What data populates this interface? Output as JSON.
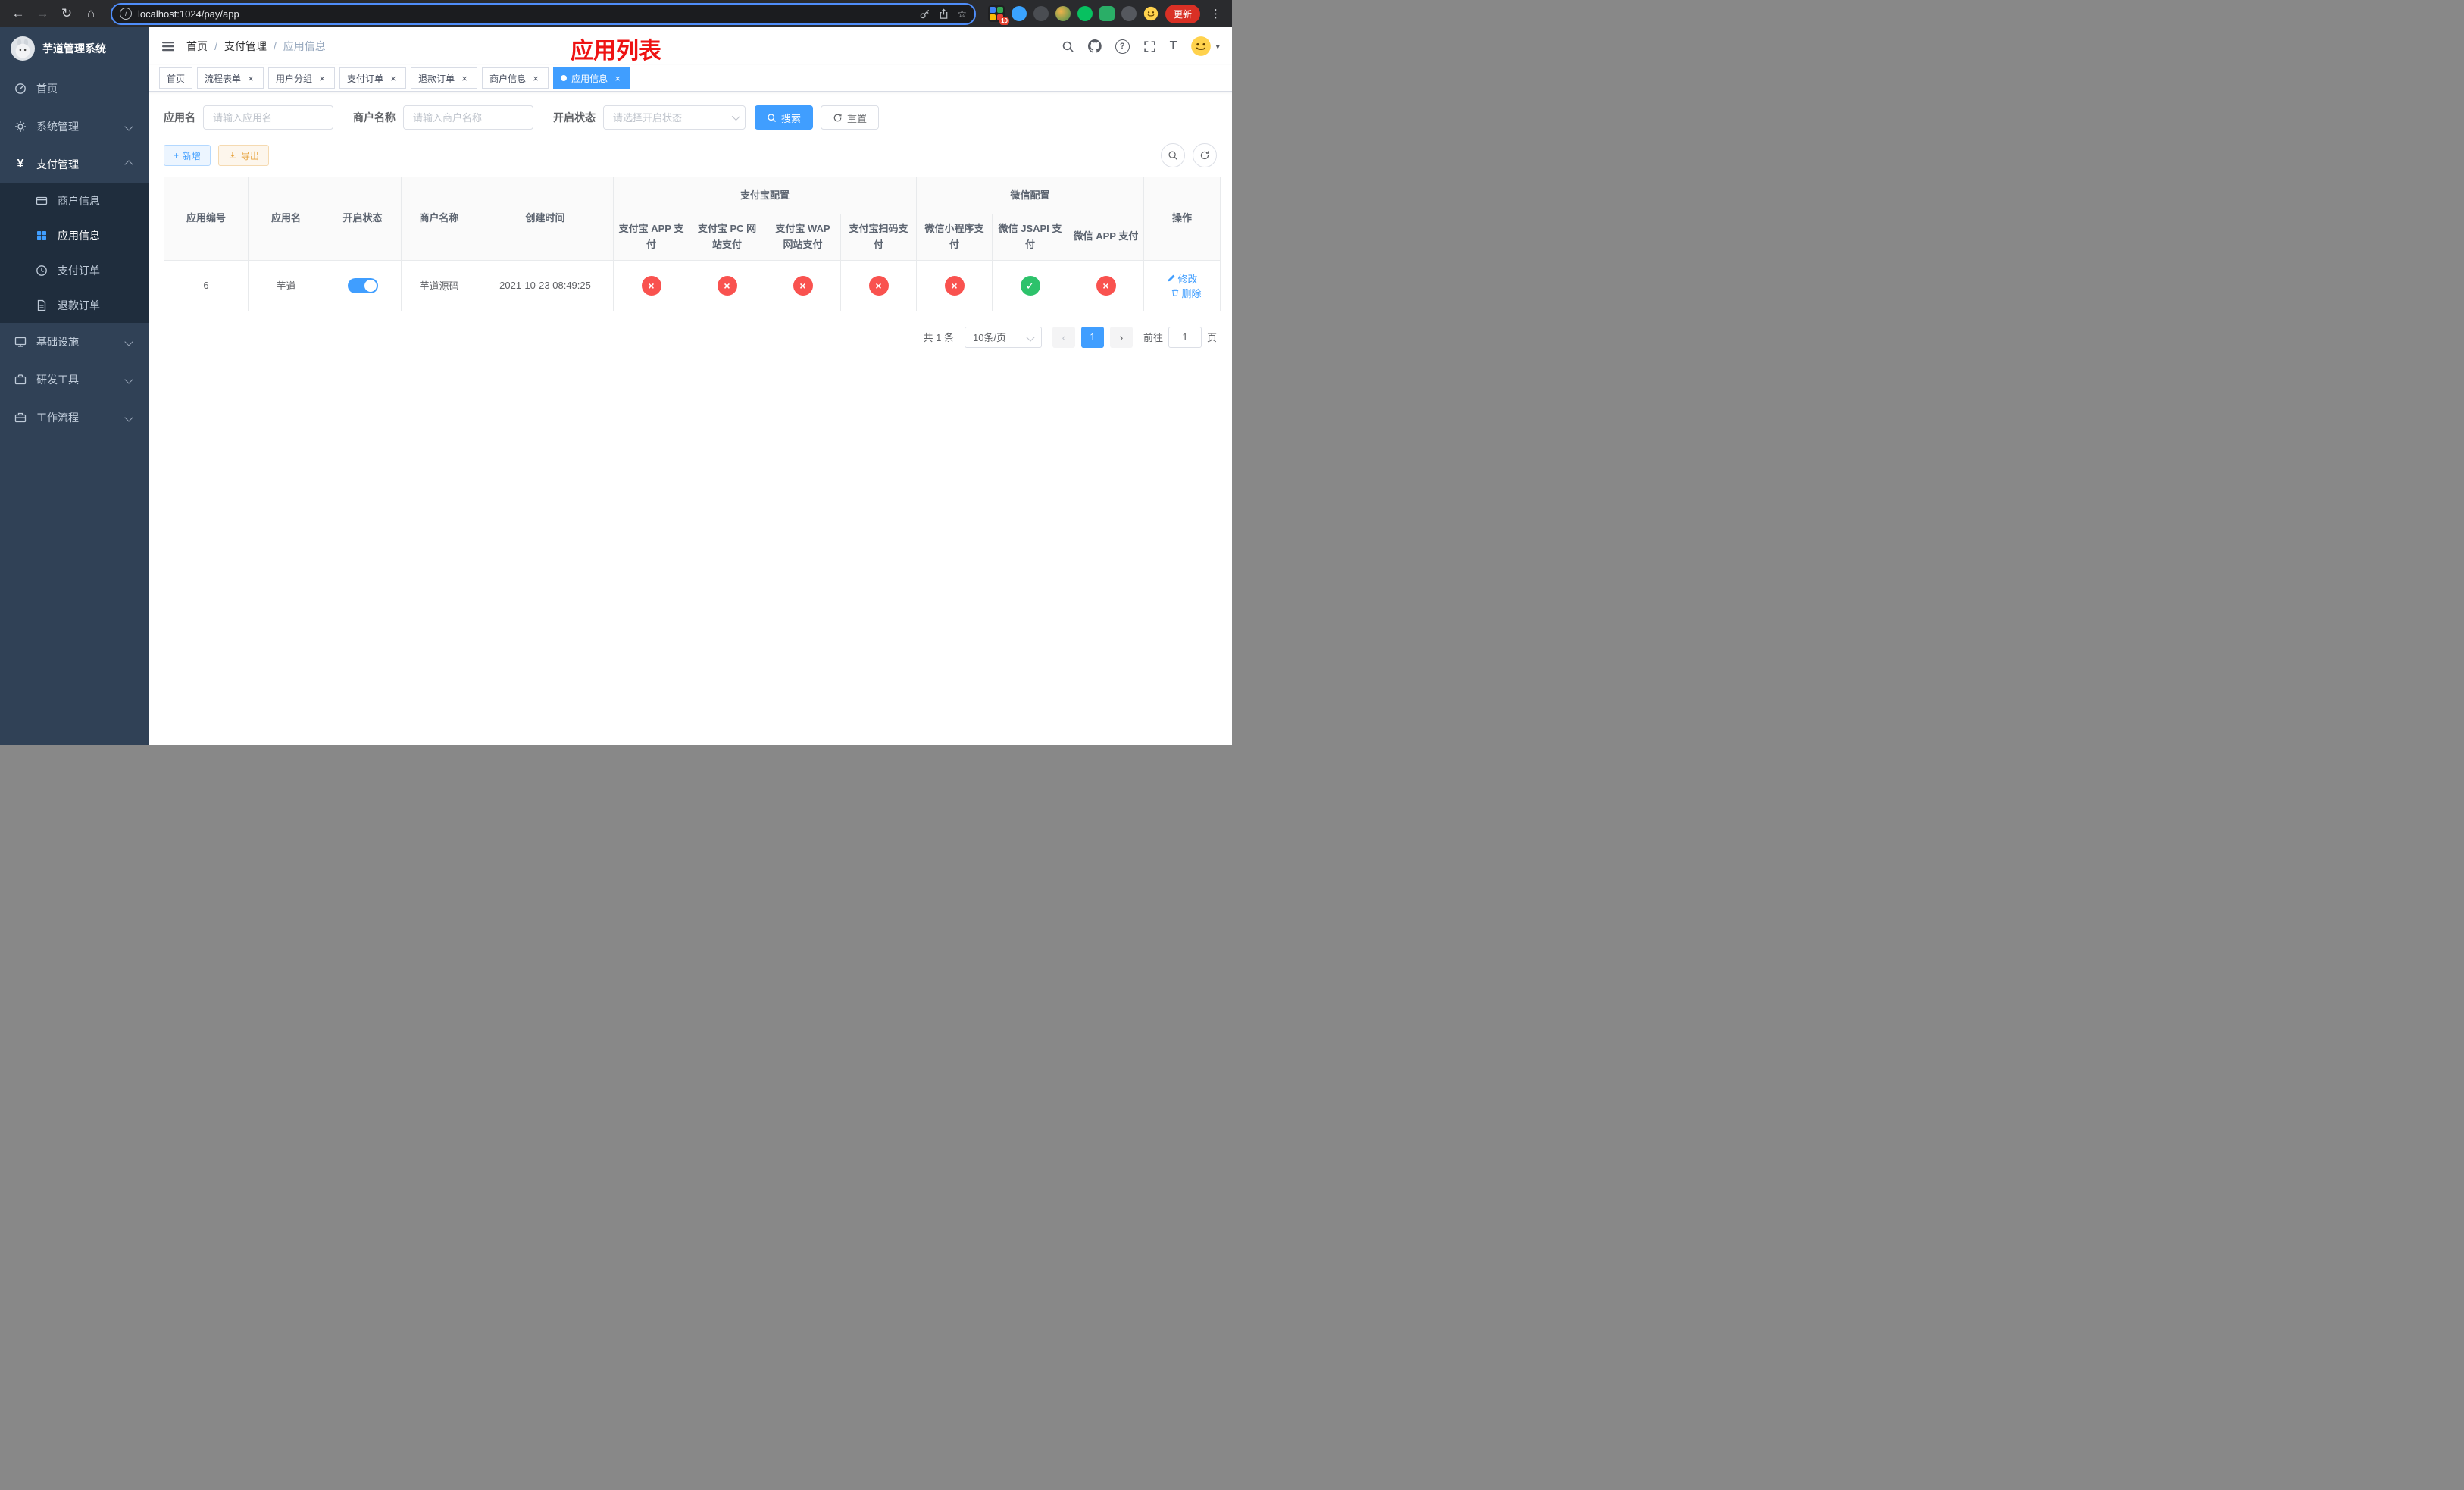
{
  "colors": {
    "primary": "#409eff",
    "success": "#2dc26b",
    "danger": "#f9524f",
    "warning": "#e6a23c",
    "sidebar_bg": "#304156",
    "sidebar_submenu_bg": "#1f2d3d",
    "annotation_red": "#ee1313"
  },
  "browser": {
    "url": "localhost:1024/pay/app",
    "update_label": "更新",
    "extension_badge": "10"
  },
  "icons": {
    "back": "←",
    "forward": "→",
    "reload": "↻",
    "home": "⌂",
    "info": "i",
    "star": "☆",
    "kebab": "⋮",
    "question": "?",
    "font_size": "T",
    "caret_down": "▾",
    "plus": "+",
    "close": "×",
    "check": "✓",
    "cross": "×",
    "prev": "‹",
    "next": "›",
    "yen": "¥"
  },
  "sidebar": {
    "title": "芋道管理系统",
    "items": [
      {
        "label": "首页"
      },
      {
        "label": "系统管理"
      },
      {
        "label": "支付管理",
        "children": [
          {
            "label": "商户信息"
          },
          {
            "label": "应用信息"
          },
          {
            "label": "支付订单"
          },
          {
            "label": "退款订单"
          }
        ]
      },
      {
        "label": "基础设施"
      },
      {
        "label": "研发工具"
      },
      {
        "label": "工作流程"
      }
    ]
  },
  "navbar": {
    "breadcrumb": [
      "首页",
      "支付管理",
      "应用信息"
    ],
    "separator": "/",
    "annotation": "应用列表"
  },
  "tabs": [
    {
      "label": "首页",
      "closable": false,
      "active": false
    },
    {
      "label": "流程表单",
      "closable": true,
      "active": false
    },
    {
      "label": "用户分组",
      "closable": true,
      "active": false
    },
    {
      "label": "支付订单",
      "closable": true,
      "active": false
    },
    {
      "label": "退款订单",
      "closable": true,
      "active": false
    },
    {
      "label": "商户信息",
      "closable": true,
      "active": false
    },
    {
      "label": "应用信息",
      "closable": true,
      "active": true
    }
  ],
  "filters": {
    "app_name_label": "应用名",
    "app_name_placeholder": "请输入应用名",
    "merchant_label": "商户名称",
    "merchant_placeholder": "请输入商户名称",
    "status_label": "开启状态",
    "status_placeholder": "请选择开启状态",
    "search_label": "搜索",
    "reset_label": "重置"
  },
  "toolbar": {
    "add_label": "新增",
    "export_label": "导出"
  },
  "table": {
    "col_app_id": "应用编号",
    "col_app_name": "应用名",
    "col_status": "开启状态",
    "col_merchant": "商户名称",
    "col_created": "创建时间",
    "group_alipay": "支付宝配置",
    "group_wechat": "微信配置",
    "sub_headers_alipay": [
      "支付宝 APP 支付",
      "支付宝 PC 网站支付",
      "支付宝 WAP 网站支付",
      "支付宝扫码支付"
    ],
    "sub_headers_wechat": [
      "微信小程序支付",
      "微信 JSAPI 支付",
      "微信 APP 支付"
    ],
    "col_actions": "操作",
    "rows": [
      {
        "id": "6",
        "name": "芋道",
        "enabled": true,
        "merchant": "芋道源码",
        "created": "2021-10-23 08:49:25",
        "alipay_app": false,
        "alipay_pc": false,
        "alipay_wap": false,
        "alipay_qr": false,
        "wechat_mini": false,
        "wechat_jsapi": true,
        "wechat_app": false,
        "edit_label": "修改",
        "delete_label": "删除"
      }
    ]
  },
  "pagination": {
    "total_label": "共 1 条",
    "page_size_label": "10条/页",
    "current_page": "1",
    "goto_label": "前往",
    "goto_value": "1",
    "page_unit": "页"
  }
}
